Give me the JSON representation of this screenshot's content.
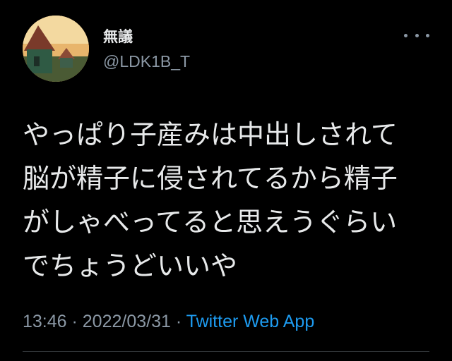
{
  "author": {
    "display_name": "無議",
    "username": "@LDK1B_T"
  },
  "tweet": {
    "lines": [
      "やっぱり子産みは中出しされて",
      "脳が精子に侵されてるから精子",
      "がしゃべってると思えうぐらい",
      "でちょうどいいや"
    ]
  },
  "meta": {
    "time": "13:46",
    "separator": " · ",
    "date": "2022/03/31",
    "source": "Twitter Web App"
  },
  "icons": {
    "more": "more-horizontal-icon"
  },
  "colors": {
    "background": "#000000",
    "text": "#e7e9ea",
    "secondary": "#8b98a5",
    "link": "#1d9bf0"
  }
}
